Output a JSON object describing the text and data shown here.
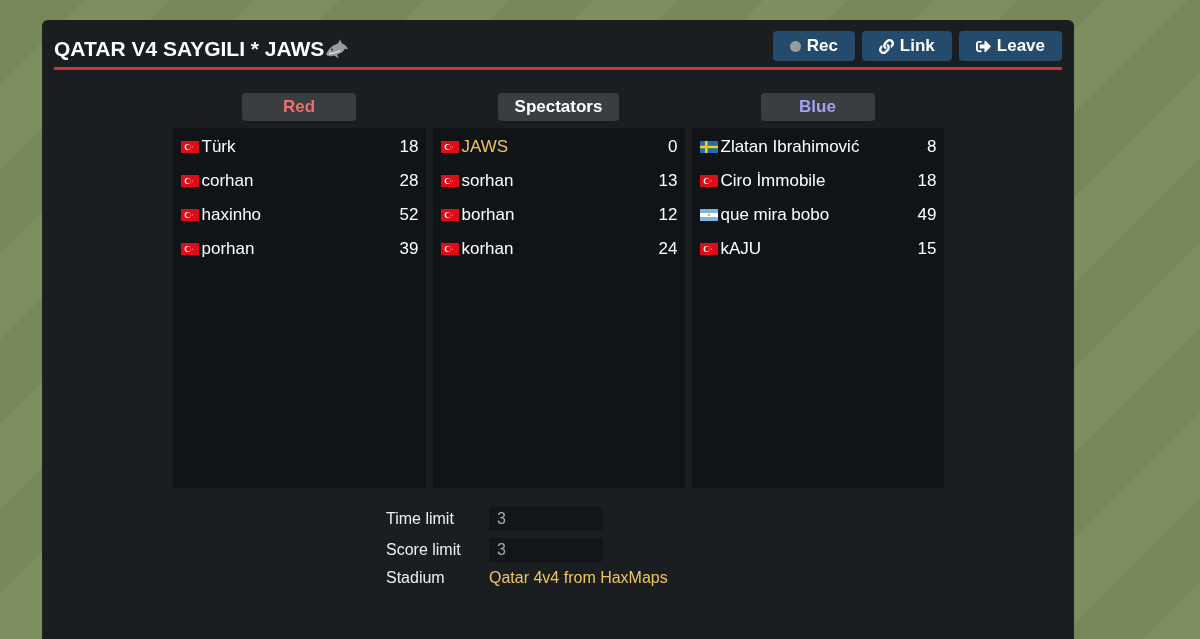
{
  "room": {
    "title": "QATAR V4 SAYGILI * JAWS"
  },
  "buttons": [
    {
      "kind": "record",
      "label": "Rec",
      "recording": false
    },
    {
      "kind": "link",
      "label": "Link"
    },
    {
      "kind": "leave",
      "label": "Leave"
    }
  ],
  "teams": [
    {
      "kind": "red",
      "name": "Red",
      "players": [
        {
          "kind": "turkish",
          "name": "Türk",
          "number": "18",
          "highlighted": false
        },
        {
          "kind": "turkish",
          "name": "corhan",
          "number": "28",
          "highlighted": false
        },
        {
          "kind": "turkish",
          "name": "haxinho",
          "number": "52",
          "highlighted": false
        },
        {
          "kind": "turkish",
          "name": "porhan",
          "number": "39",
          "highlighted": false
        }
      ]
    },
    {
      "kind": "spectators",
      "name": "Spectators",
      "players": [
        {
          "kind": "turkish",
          "name": "JAWS",
          "number": "0",
          "highlighted": true
        },
        {
          "kind": "turkish",
          "name": "sorhan",
          "number": "13",
          "highlighted": false
        },
        {
          "kind": "turkish",
          "name": "borhan",
          "number": "12",
          "highlighted": false
        },
        {
          "kind": "turkish",
          "name": "korhan",
          "number": "24",
          "highlighted": false
        }
      ]
    },
    {
      "kind": "blue",
      "name": "Blue",
      "players": [
        {
          "kind": "swedish",
          "name": "Zlatan Ibrahimović",
          "number": "8",
          "highlighted": false
        },
        {
          "kind": "turkish",
          "name": "Ciro İmmobile",
          "number": "18",
          "highlighted": false
        },
        {
          "kind": "argentine",
          "name": "que mira bobo",
          "number": "49",
          "highlighted": false
        },
        {
          "kind": "turkish",
          "name": "kAJU",
          "number": "15",
          "highlighted": false
        }
      ]
    }
  ],
  "settings": [
    {
      "kind": "input",
      "label": "Time limit",
      "value": "3"
    },
    {
      "kind": "input",
      "label": "Score limit",
      "value": "3"
    },
    {
      "kind": "link",
      "label": "Stadium",
      "value": "Qatar 4v4 from HaxMaps"
    }
  ]
}
